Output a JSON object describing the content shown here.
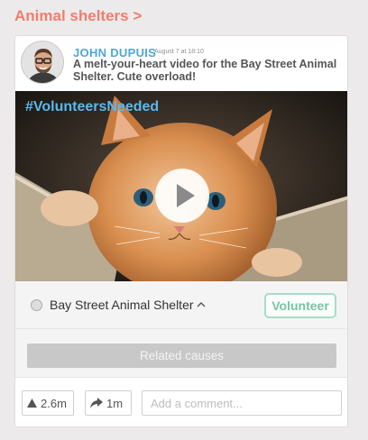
{
  "section": {
    "title": "Animal shelters >"
  },
  "post": {
    "author": "JOHN DUPUIS",
    "timestamp": "August 7 at 18:10",
    "text": "A melt-your-heart video for the Bay Street Animal Shelter. Cute overload!",
    "hashtag": "#VolunteersNeeded"
  },
  "org": {
    "name": "Bay Street Animal Shelter",
    "volunteer_label": "Volunteer"
  },
  "related": {
    "label": "Related causes"
  },
  "actions": {
    "upvote_count": "2.6m",
    "share_count": "1m",
    "comment_placeholder": "Add a comment..."
  },
  "icons": {
    "play": "play-icon",
    "upvote": "triangle-up-icon",
    "share": "share-arrow-icon",
    "chevron": "chevron-up-icon"
  },
  "colors": {
    "accent": "#f07e6e",
    "author": "#4aa9d9",
    "hashtag": "#5bb8ec",
    "volunteer": "#79c3a6"
  }
}
